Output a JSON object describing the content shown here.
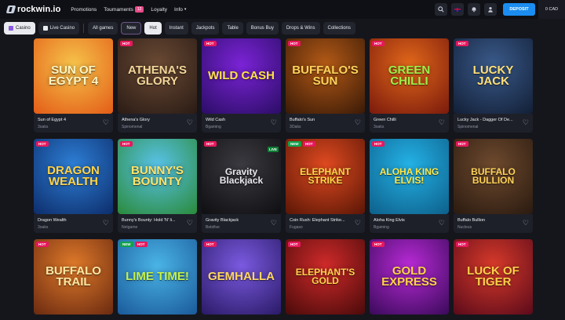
{
  "header": {
    "logo": "rockwin.io",
    "nav": [
      {
        "label": "Promotions"
      },
      {
        "label": "Tournaments",
        "badge": "12"
      },
      {
        "label": "Loyalty"
      },
      {
        "label": "Info"
      }
    ],
    "deposit_label": "DEPOSIT",
    "balance": "0 CAD"
  },
  "filters": [
    {
      "label": "Casino",
      "active": true
    },
    {
      "label": "Live Casino"
    },
    {
      "label": "All games"
    },
    {
      "label": "New",
      "outlined": true
    },
    {
      "label": "Hot"
    },
    {
      "label": "Instant"
    },
    {
      "label": "Jackpots"
    },
    {
      "label": "Table"
    },
    {
      "label": "Bonus Buy"
    },
    {
      "label": "Drops & Wins"
    },
    {
      "label": "Collections"
    }
  ],
  "games": [
    {
      "name": "Sun of Egypt 4",
      "provider": "3oaks",
      "art": "SUN OF EGYPT 4",
      "bg1": "#f6c34a",
      "bg2": "#e35c17",
      "fg": "#fff6c2",
      "tags": []
    },
    {
      "name": "Athena's Glory",
      "provider": "Spinomenal",
      "art": "ATHENA'S GLORY",
      "bg1": "#6a4a34",
      "bg2": "#2a1b15",
      "fg": "#f3d69a",
      "tags": [
        "HOT"
      ]
    },
    {
      "name": "Wild Cash",
      "provider": "Bgaming",
      "art": "WILD CASH",
      "bg1": "#7b23d6",
      "bg2": "#2b0d66",
      "fg": "#ffe14d",
      "tags": [
        "HOT"
      ]
    },
    {
      "name": "Buffalo's Sun",
      "provider": "3Oaks",
      "art": "BUFFALO'S SUN",
      "bg1": "#b45a16",
      "bg2": "#3a1a07",
      "fg": "#ffd35a",
      "tags": [
        "HOT"
      ]
    },
    {
      "name": "Green Chilli",
      "provider": "3oaks",
      "art": "GREEN CHILLI",
      "bg1": "#e1671a",
      "bg2": "#7a1a0c",
      "fg": "#9cf04a",
      "tags": [
        "HOT"
      ]
    },
    {
      "name": "Lucky Jack - Dagger Of De...",
      "provider": "Spinomenal",
      "art": "LUCKY JACK",
      "bg1": "#3a5a8a",
      "bg2": "#121f36",
      "fg": "#ffe07a",
      "tags": [
        "HOT"
      ]
    },
    {
      "name": "Dragon Wealth",
      "provider": "3oaks",
      "art": "DRAGON WEALTH",
      "bg1": "#2d7fd6",
      "bg2": "#0d2d6b",
      "fg": "#ffd34a",
      "tags": [
        "HOT"
      ]
    },
    {
      "name": "Bunny's Bounty: Hold 'N' li...",
      "provider": "Netgame",
      "art": "BUNNY'S BOUNTY",
      "bg1": "#58c2e8",
      "bg2": "#2a8a3a",
      "fg": "#ffe36a",
      "tags": [
        "HOT"
      ]
    },
    {
      "name": "Gravity Blackjack",
      "provider": "Betsfive",
      "art": "Gravity Blackjack",
      "bg1": "#3a3a40",
      "bg2": "#0f0f12",
      "fg": "#e9e9ee",
      "tags": [
        "HOT"
      ],
      "live": "LIVE"
    },
    {
      "name": "Coin Rush: Elephant Strike...",
      "provider": "Fugaso",
      "art": "ELEPHANT STRIKE",
      "bg1": "#e04a20",
      "bg2": "#5a1606",
      "fg": "#ffd84a",
      "tags": [
        "NEW",
        "HOT"
      ]
    },
    {
      "name": "Aloha King Elvis",
      "provider": "Bgaming",
      "art": "ALOHA KING ELVIS!",
      "bg1": "#24b2e6",
      "bg2": "#0d5f8a",
      "fg": "#ffe94a",
      "tags": [
        "HOT"
      ]
    },
    {
      "name": "Buffalo Bullion",
      "provider": "Nucleus",
      "art": "BUFFALO BULLION",
      "bg1": "#6e4a2e",
      "bg2": "#2a1a10",
      "fg": "#ffd35a",
      "tags": [
        "HOT"
      ]
    },
    {
      "name": "",
      "provider": "",
      "art": "BUFFALO TRAIL",
      "bg1": "#e07a2a",
      "bg2": "#6a2a10",
      "fg": "#ffe8a0",
      "tags": [
        "HOT"
      ]
    },
    {
      "name": "",
      "provider": "",
      "art": "LIME TIME!",
      "bg1": "#4ab4e6",
      "bg2": "#1a5a9a",
      "fg": "#c6f24a",
      "tags": [
        "NEW",
        "HOT"
      ]
    },
    {
      "name": "",
      "provider": "",
      "art": "GEMHALLA",
      "bg1": "#7a5ae0",
      "bg2": "#2a1a66",
      "fg": "#ffd860",
      "tags": [
        "HOT"
      ]
    },
    {
      "name": "",
      "provider": "",
      "art": "ELEPHANT'S GOLD",
      "bg1": "#d02a2a",
      "bg2": "#4a0a0a",
      "fg": "#ffd34a",
      "tags": [
        "HOT"
      ]
    },
    {
      "name": "",
      "provider": "",
      "art": "GOLD EXPRESS",
      "bg1": "#b82ad6",
      "bg2": "#3a0a5a",
      "fg": "#ffd34a",
      "tags": [
        "HOT"
      ]
    },
    {
      "name": "",
      "provider": "",
      "art": "LUCK OF TIGER",
      "bg1": "#d83a2a",
      "bg2": "#5a0a1a",
      "fg": "#ffcf4a",
      "tags": [
        "HOT"
      ]
    }
  ]
}
